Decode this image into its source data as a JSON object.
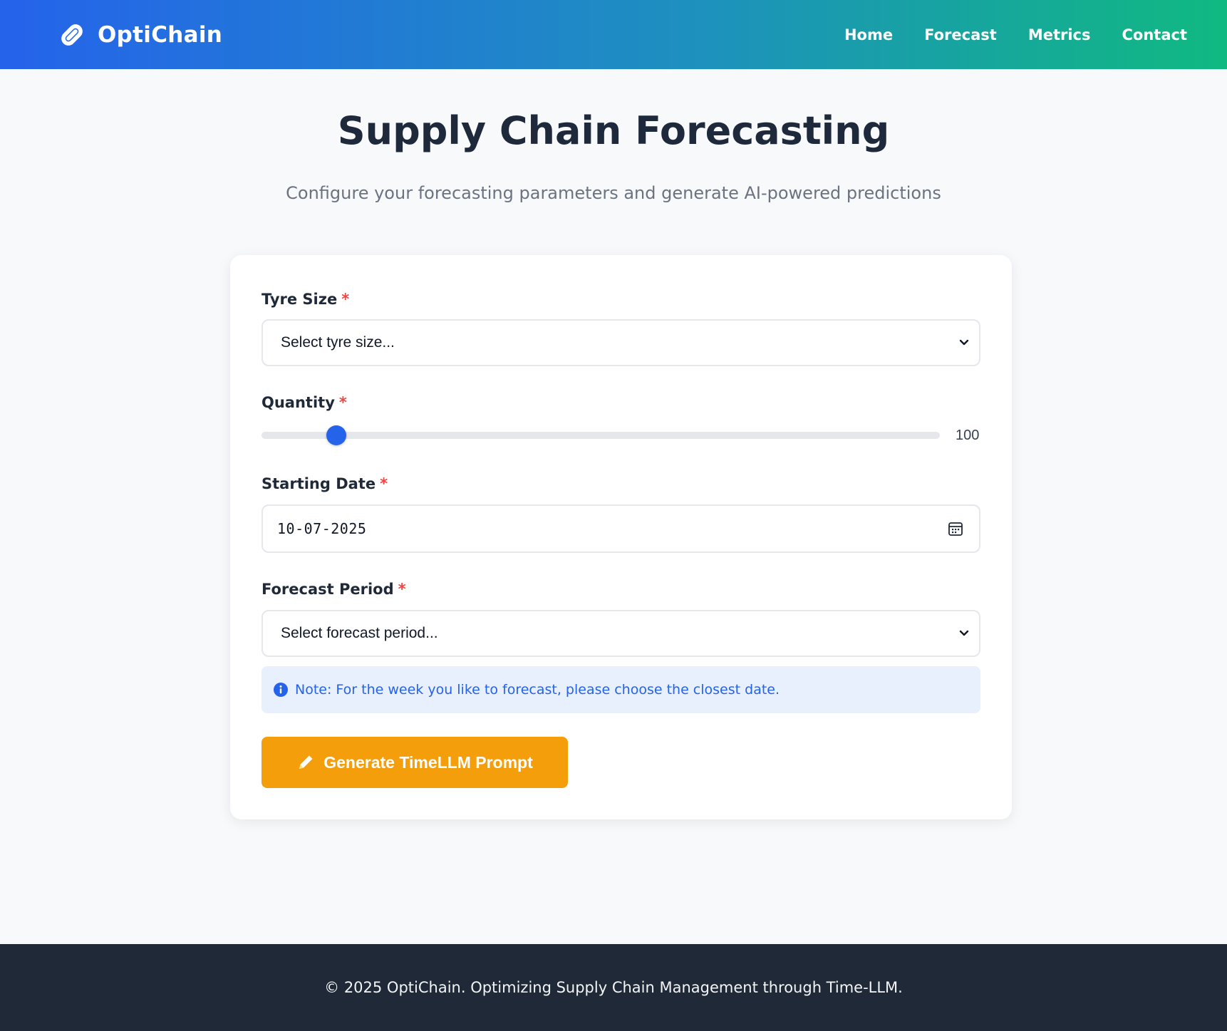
{
  "nav": {
    "brand": "OptiChain",
    "brand_icon": "link-icon",
    "links": [
      "Home",
      "Forecast",
      "Metrics",
      "Contact"
    ],
    "gradient": [
      "#2563eb",
      "#10b981"
    ]
  },
  "header": {
    "title": "Supply Chain Forecasting",
    "subtitle": "Configure your forecasting parameters and generate AI-powered predictions"
  },
  "form": {
    "tyre_size": {
      "label": "Tyre Size",
      "required": "*",
      "placeholder": "Select tyre size..."
    },
    "quantity": {
      "label": "Quantity",
      "required": "*",
      "value": "100",
      "slider_fraction": 0.11
    },
    "start_date": {
      "label": "Starting Date",
      "required": "*",
      "value": "10-07-2025",
      "icon": "calendar-icon"
    },
    "forecast_period": {
      "label": "Forecast Period",
      "required": "*",
      "placeholder": "Select forecast period..."
    },
    "note": {
      "icon": "info-icon",
      "text": "Note: For the week you like to forecast, please choose the closest date."
    },
    "submit": {
      "icon": "pencil-icon",
      "label": "Generate TimeLLM Prompt"
    }
  },
  "colors": {
    "accent": "#2563eb",
    "button": "#f59e0b",
    "required": "#ef4444",
    "footer_bg": "#1f2937"
  },
  "footer": {
    "text": "© 2025 OptiChain. Optimizing Supply Chain Management through Time-LLM."
  }
}
